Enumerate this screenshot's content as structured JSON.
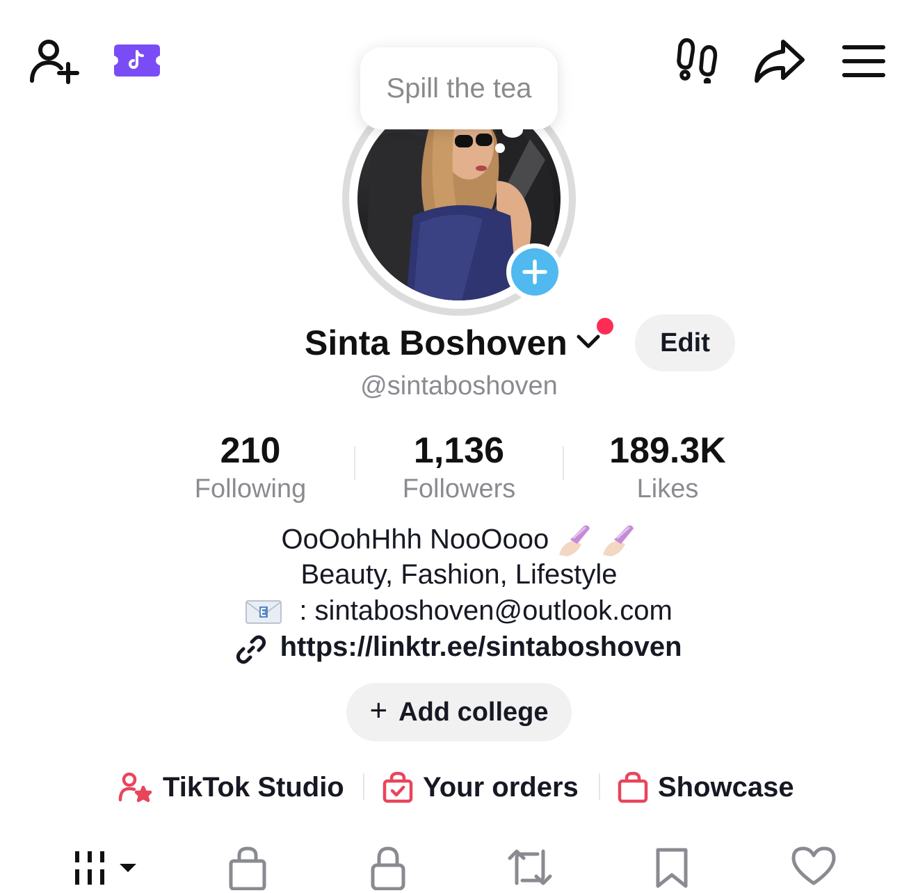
{
  "header": {
    "icons": [
      "add-friend-icon",
      "tiktok-ticket-icon",
      "footprints-icon",
      "share-icon",
      "menu-icon"
    ]
  },
  "tooltip": {
    "text": "Spill the tea"
  },
  "profile": {
    "name": "Sinta Boshoven",
    "handle": "@sintaboshoven",
    "edit_label": "Edit"
  },
  "stats": [
    {
      "value": "210",
      "label": "Following"
    },
    {
      "value": "1,136",
      "label": "Followers"
    },
    {
      "value": "189.3K",
      "label": "Likes"
    }
  ],
  "bio": {
    "line1": "OoOohHhh NooOooo",
    "line2": "Beauty, Fashion, Lifestyle",
    "line3": ": sintaboshoven@outlook.com",
    "link": "https://linktr.ee/sintaboshoven"
  },
  "add_college": {
    "plus": "+",
    "label": "Add college"
  },
  "shortcuts": [
    {
      "label": "TikTok Studio",
      "icon": "creator-star-icon"
    },
    {
      "label": "Your orders",
      "icon": "orders-bag-icon"
    },
    {
      "label": "Showcase",
      "icon": "showcase-bag-icon"
    }
  ],
  "tabs": [
    "videos-grid-icon",
    "shop-bag-icon",
    "private-lock-icon",
    "reposts-icon",
    "favorites-bookmark-icon",
    "liked-heart-icon"
  ],
  "colors": {
    "accent_red": "#fe2c55",
    "story_blue": "#4fb9f0",
    "ticket_purple": "#7a4cf5",
    "muted_text": "#8a8b91"
  }
}
